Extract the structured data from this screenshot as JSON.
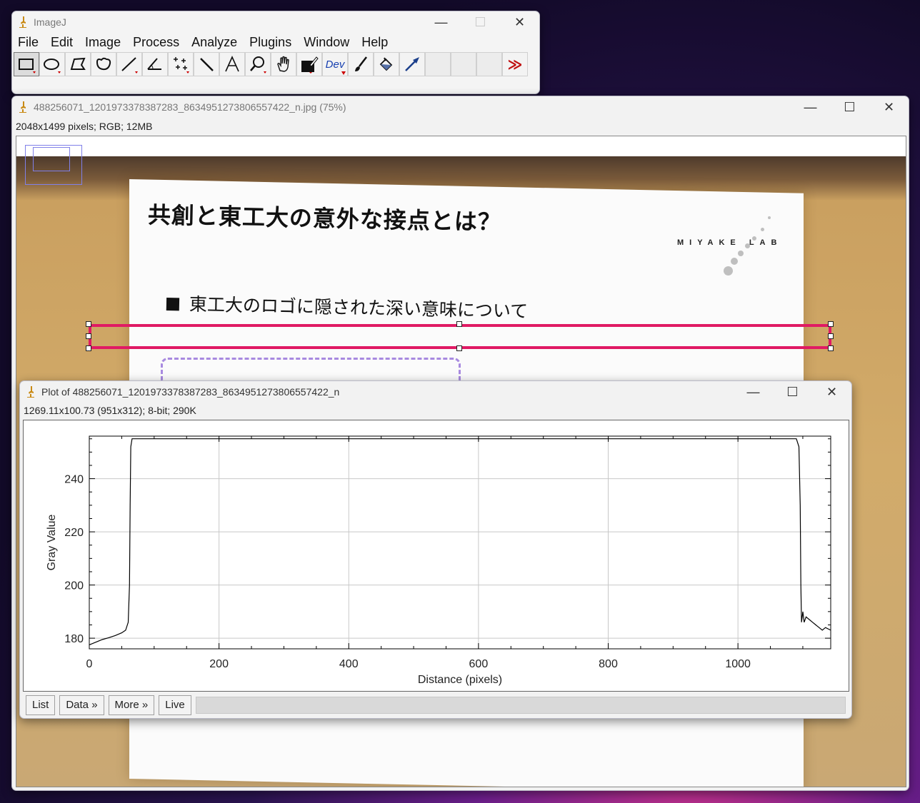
{
  "main_window": {
    "title": "ImageJ",
    "menu": [
      "File",
      "Edit",
      "Image",
      "Process",
      "Analyze",
      "Plugins",
      "Window",
      "Help"
    ],
    "tools": [
      {
        "name": "rectangle-tool-icon",
        "selected": true
      },
      {
        "name": "oval-tool-icon"
      },
      {
        "name": "polygon-tool-icon"
      },
      {
        "name": "freehand-tool-icon"
      },
      {
        "name": "line-tool-icon"
      },
      {
        "name": "angle-tool-icon"
      },
      {
        "name": "multipoint-tool-icon"
      },
      {
        "name": "wand-tool-icon"
      },
      {
        "name": "text-tool-icon"
      },
      {
        "name": "magnifier-tool-icon"
      },
      {
        "name": "hand-tool-icon"
      },
      {
        "name": "color-picker-icon"
      },
      {
        "name": "dev-tool-icon",
        "label": "Dev"
      },
      {
        "name": "brush-tool-icon"
      },
      {
        "name": "flood-fill-icon"
      },
      {
        "name": "arrow-tool-icon"
      }
    ],
    "more_tools": "≫"
  },
  "image_window": {
    "title": "488256071_1201973378387283_8634951273806557422_n.jpg (75%)",
    "info": "2048x1499 pixels; RGB; 12MB",
    "slide": {
      "title": "共創と東工大の意外な接点とは？",
      "bullet": "東工大のロゴに隠された深い意味について",
      "logo_text": "MIYAKE LAB"
    }
  },
  "plot_window": {
    "title": "Plot of 488256071_1201973378387283_8634951273806557422_n",
    "info": "1269.11x100.73  (951x312); 8-bit; 290K",
    "buttons": {
      "list": "List",
      "data": "Data »",
      "more": "More »",
      "live": "Live"
    }
  },
  "chart_data": {
    "type": "line",
    "xlabel": "Distance (pixels)",
    "ylabel": "Gray Value",
    "xlim": [
      0,
      1143
    ],
    "ylim": [
      176,
      256
    ],
    "xticks": [
      0,
      200,
      400,
      600,
      800,
      1000
    ],
    "yticks": [
      180,
      200,
      220,
      240
    ],
    "grid": true,
    "color": "#000000",
    "x": [
      0,
      10,
      20,
      30,
      40,
      50,
      56,
      60,
      62,
      63,
      64,
      66,
      70,
      100,
      300,
      600,
      900,
      1090,
      1094,
      1096,
      1097,
      1098,
      1100,
      1102,
      1105,
      1110,
      1115,
      1120,
      1125,
      1130,
      1135,
      1143
    ],
    "y": [
      177.5,
      178.5,
      179.5,
      180.2,
      181,
      182,
      183,
      186,
      200,
      230,
      252,
      255,
      255,
      255,
      255,
      255,
      255,
      255,
      252,
      230,
      200,
      186,
      190,
      186,
      188,
      187,
      186,
      185,
      184,
      183,
      184,
      183
    ]
  }
}
